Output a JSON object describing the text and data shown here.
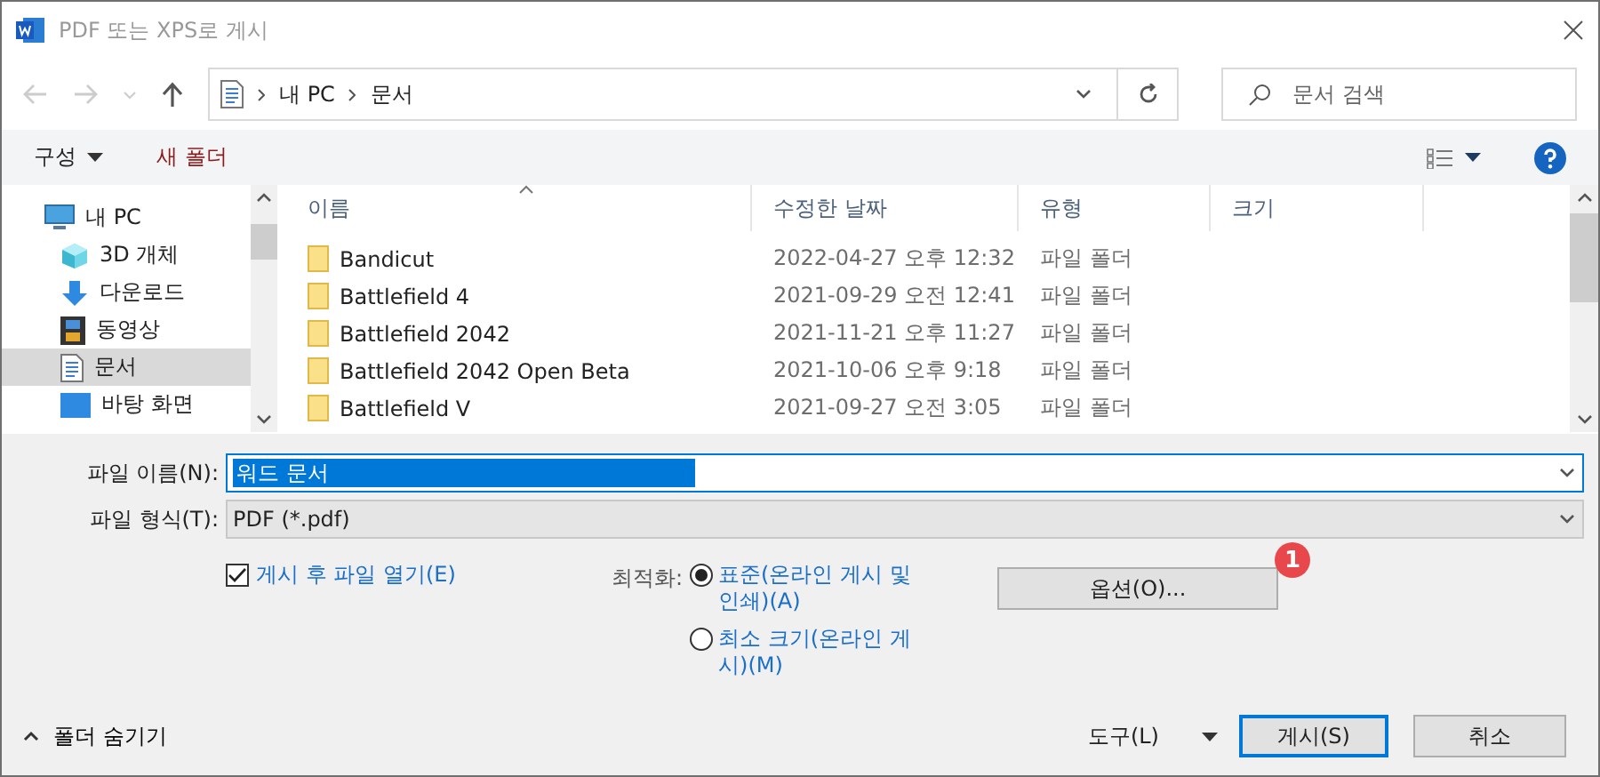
{
  "window": {
    "title": "PDF 또는 XPS로 게시"
  },
  "nav": {
    "path": [
      "내 PC",
      "문서"
    ],
    "search": {
      "placeholder": "문서 검색"
    }
  },
  "toolbar": {
    "organize": "구성",
    "new_folder": "새 폴더"
  },
  "sidebar": {
    "items": [
      {
        "label": "내 PC",
        "kind": "pc",
        "selected": false,
        "indent": false
      },
      {
        "label": "3D 개체",
        "kind": "cube",
        "selected": false,
        "indent": true
      },
      {
        "label": "다운로드",
        "kind": "download",
        "selected": false,
        "indent": true
      },
      {
        "label": "동영상",
        "kind": "video",
        "selected": false,
        "indent": true
      },
      {
        "label": "문서",
        "kind": "document",
        "selected": true,
        "indent": true
      },
      {
        "label": "바탕 화면",
        "kind": "desktop",
        "selected": false,
        "indent": true
      }
    ]
  },
  "table": {
    "columns": [
      {
        "label": "이름",
        "sorted": true
      },
      {
        "label": "수정한 날짜",
        "sorted": false
      },
      {
        "label": "유형",
        "sorted": false
      },
      {
        "label": "크기",
        "sorted": false
      }
    ],
    "rows": [
      {
        "name": "Bandicut",
        "modified": "2022-04-27 오후 12:32",
        "type": "파일 폴더"
      },
      {
        "name": "Battlefield 4",
        "modified": "2021-09-29 오전 12:41",
        "type": "파일 폴더"
      },
      {
        "name": "Battlefield 2042",
        "modified": "2021-11-21 오후 11:27",
        "type": "파일 폴더"
      },
      {
        "name": "Battlefield 2042 Open Beta",
        "modified": "2021-10-06 오후 9:18",
        "type": "파일 폴더"
      },
      {
        "name": "Battlefield V",
        "modified": "2021-09-27 오전 3:05",
        "type": "파일 폴더"
      }
    ]
  },
  "form": {
    "file_name": {
      "label": "파일 이름(N):",
      "value": "워드 문서"
    },
    "file_type": {
      "label": "파일 형식(T):",
      "value": "PDF (*.pdf)"
    },
    "open_after": {
      "label": "게시 후 파일 열기(E)",
      "checked": true
    },
    "optimize": {
      "label": "최적화:",
      "options": [
        {
          "label": "표준(온라인 게시 및 인쇄)(A)",
          "selected": true
        },
        {
          "label": "최소 크기(온라인 게시)(M)",
          "selected": false
        }
      ]
    },
    "options_button": "옵션(O)...",
    "callout": "1"
  },
  "footer": {
    "hide_folders": "폴더 숨기기",
    "tools": "도구(L)",
    "publish": "게시(S)",
    "cancel": "취소"
  }
}
